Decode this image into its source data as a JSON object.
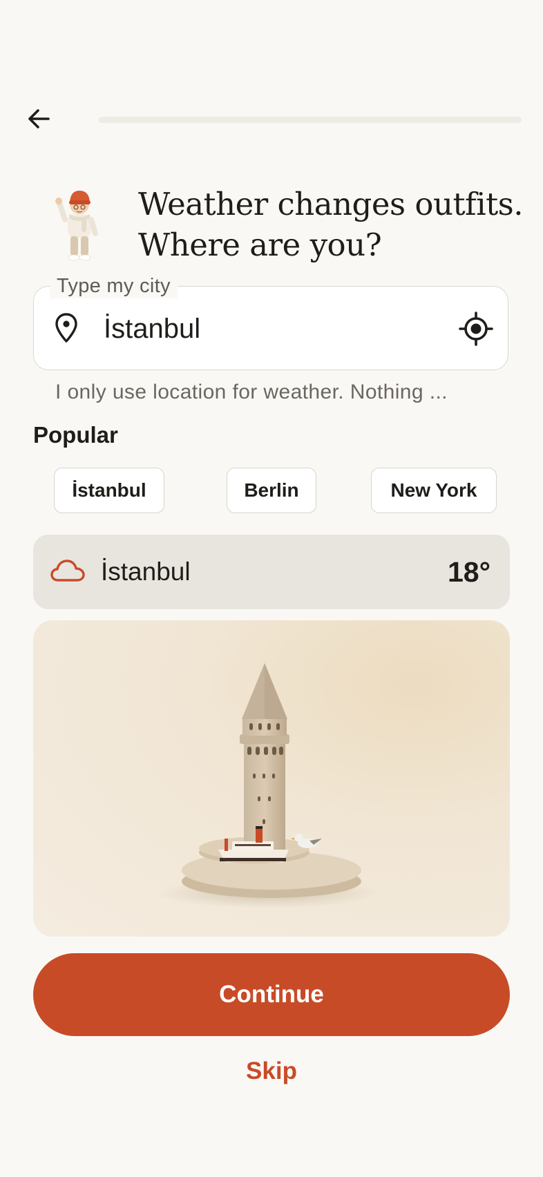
{
  "header": {
    "progress_fraction": 0.0,
    "headline_line1": "Weather changes outfits.",
    "headline_line2": "Where are you?"
  },
  "city_field": {
    "label": "Type my city",
    "value": "İstanbul",
    "helper_text": "I only use location for weather. Nothing ..."
  },
  "popular": {
    "title": "Popular",
    "chips": [
      "İstanbul",
      "Berlin",
      "New York"
    ]
  },
  "weather": {
    "city": "İstanbul",
    "temperature": "18°",
    "icon": "cloud-icon"
  },
  "actions": {
    "continue_label": "Continue",
    "skip_label": "Skip"
  },
  "colors": {
    "accent": "#c84b27",
    "background": "#f9f8f5",
    "card": "#e8e5df"
  }
}
